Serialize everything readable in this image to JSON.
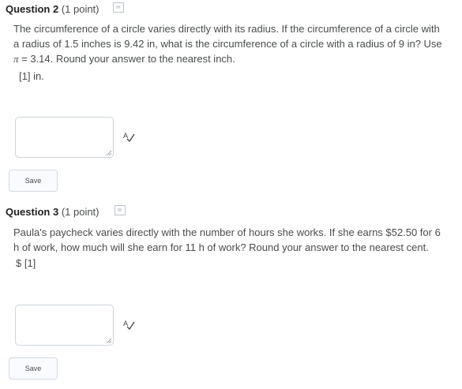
{
  "questions": [
    {
      "title": "Question 2",
      "points": "(1 point)",
      "text_before_pi": "The circumference of a circle varies directly with its radius. If the circumference of a circle with a radius of 1.5 inches is 9.42 in, what is the circumference of a circle with a radius of 9 in? Use ",
      "pi_symbol": "π",
      "text_after_pi": " = 3.14. Round your answer to the nearest inch.",
      "blank_line": "[1] in.",
      "answer_value": "",
      "save_label": "Save"
    },
    {
      "title": "Question 3",
      "points": "(1 point)",
      "text": "Paula's paycheck varies directly with the number of hours she works. If she earns $52.50 for 6 h of work, how much will she earn for 11 h of work? Round your answer to the nearest cent.",
      "blank_line": "$ [1]",
      "answer_value": "",
      "save_label": "Save"
    }
  ],
  "icons": {
    "save_state": "save-state-icon",
    "spell_check": "spell-check-icon"
  },
  "colors": {
    "heading": "#202122",
    "body_text": "#494c4e",
    "field_border": "#cdd5dc"
  }
}
